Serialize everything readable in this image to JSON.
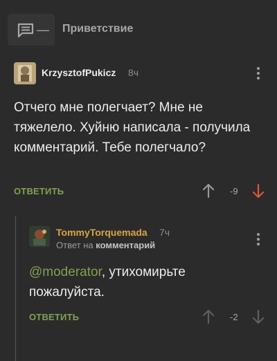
{
  "post": {
    "title": "Приветствие",
    "dash": "—",
    "icon": "comments-icon"
  },
  "comment1": {
    "username": "KrzysztofPukicz",
    "time": "8ч",
    "text": "Отчего мне полегчает? Мне не тяжелело. Хуйню написала - получила комментарий. Тебе полегчало?",
    "reply_label": "ОТВЕТИТЬ",
    "rating": "-9",
    "down_color": "#e0533c"
  },
  "comment2": {
    "username": "TommyTorquemada",
    "username_color": "#d9a53e",
    "time": "7ч",
    "reply_to_prefix": "Ответ на",
    "reply_to_link": "комментарий",
    "mention": "@moderator",
    "text_rest": ", утихомирьте пожалуйста.",
    "reply_label": "ОТВЕТИТЬ",
    "rating": "-2"
  },
  "colors": {
    "background": "#2b2b2b",
    "accent_green": "#7fa34d"
  }
}
